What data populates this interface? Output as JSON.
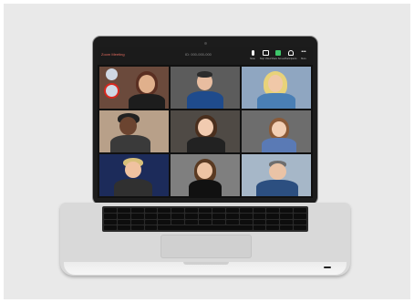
{
  "meeting": {
    "title": "Zoom Meeting",
    "id_text": "ID: 000-000-000"
  },
  "controls": [
    {
      "label": "Mute",
      "icon": "microphone-icon",
      "color": "#ffffff"
    },
    {
      "label": "Stop Video",
      "icon": "video-camera-icon",
      "color": "#ffffff"
    },
    {
      "label": "Share Screen",
      "icon": "share-screen-icon",
      "color": "#3ec86b"
    },
    {
      "label": "Participants",
      "icon": "participants-icon",
      "color": "#ffffff"
    },
    {
      "label": "More",
      "icon": "more-icon",
      "color": "#ffffff"
    }
  ],
  "participants": [
    {
      "name": "",
      "bg": "#6b4a3c",
      "skin": "#e0b08c",
      "hair": "#5a2f22",
      "shirt": "#1d1d1d"
    },
    {
      "name": "",
      "bg": "#5c5c5c",
      "skin": "#e8bda0",
      "hair": "#2c2c2c",
      "shirt": "#1f4b8c"
    },
    {
      "name": "",
      "bg": "#8fa6c1",
      "skin": "#f0c8a8",
      "hair": "#e8d27a",
      "shirt": "#4a7fb5"
    },
    {
      "name": "",
      "bg": "#b8a089",
      "skin": "#6b4430",
      "hair": "#222222",
      "shirt": "#3a3a3a"
    },
    {
      "name": "",
      "bg": "#4f4a45",
      "skin": "#f1cbb0",
      "hair": "#4a2f1e",
      "shirt": "#222222"
    },
    {
      "name": "",
      "bg": "#6d6d6d",
      "skin": "#f3cfb4",
      "hair": "#8a5a38",
      "shirt": "#5a7ab5"
    },
    {
      "name": "",
      "bg": "#1c2b5a",
      "skin": "#f0c2a0",
      "hair": "#d8c07a",
      "shirt": "#303030"
    },
    {
      "name": "",
      "bg": "#7f7f7f",
      "skin": "#edc4a4",
      "hair": "#5a3a22",
      "shirt": "#111111"
    },
    {
      "name": "",
      "bg": "#a6b7c8",
      "skin": "#eac3a6",
      "hair": "#6e6e6e",
      "shirt": "#2c4f80"
    }
  ],
  "colors": {
    "accent_selection": "#d8281f",
    "title_color": "#e26b5e"
  }
}
